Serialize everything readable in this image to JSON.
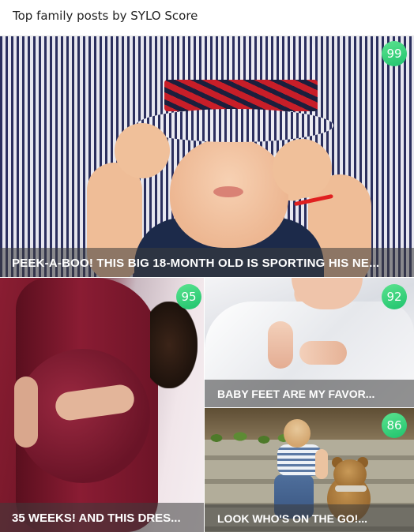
{
  "header": {
    "title": "Top family posts by SYLO Score"
  },
  "posts": [
    {
      "caption": "PEEK-A-BOO! THIS BIG 18-MONTH OLD IS SPORTING HIS NE...",
      "score": "99",
      "image": "baby-in-striped-hat"
    },
    {
      "caption": "35 WEEKS! AND THIS DRES...",
      "score": "95",
      "image": "pregnant-belly-red-dress"
    },
    {
      "caption": "BABY FEET ARE MY FAVOR...",
      "score": "92",
      "image": "newborn-baby-feet"
    },
    {
      "caption": "LOOK WHO'S ON THE GO!...",
      "score": "86",
      "image": "toddler-climbing-steps-teddy-bear"
    }
  ],
  "colors": {
    "score_badge": "#2ecc71",
    "caption_overlay": "rgba(60,60,60,0.55)",
    "caption_text": "#ffffff"
  }
}
